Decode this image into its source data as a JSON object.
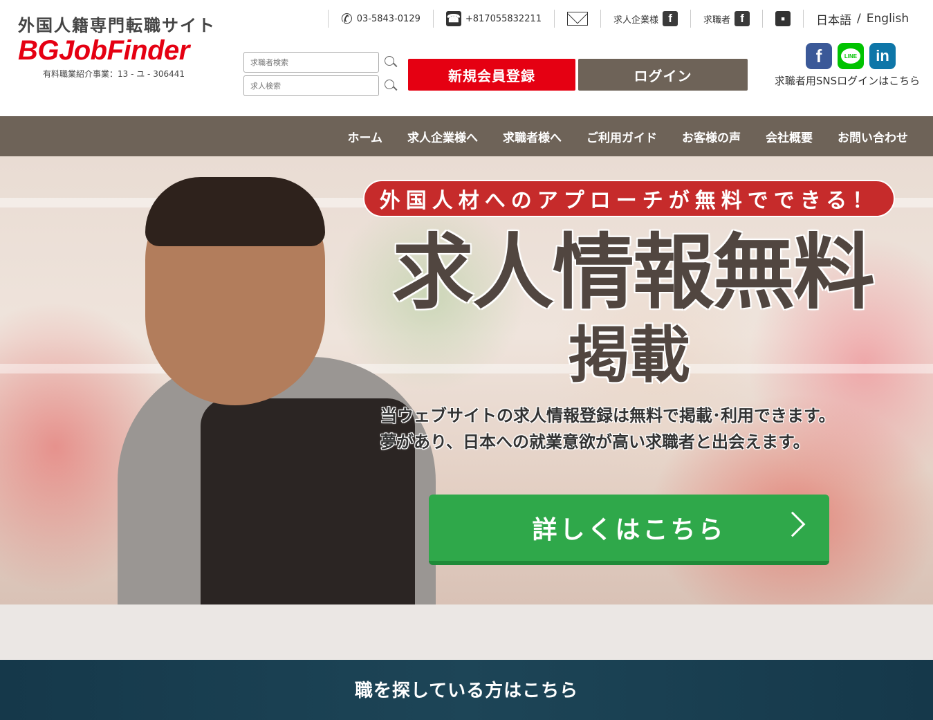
{
  "logo": {
    "tagline": "外国人籍専門転職サイト",
    "name": "BGJobFinder",
    "license": "有料職業紹介事業：13 - ユ - 306441"
  },
  "topbar": {
    "phone": "03-5843-0129",
    "viber": "+817055832211",
    "company_fb_label": "求人企業様",
    "seeker_fb_label": "求職者",
    "lang_ja": "日本語",
    "lang_sep": "/",
    "lang_en": "English"
  },
  "search": {
    "seeker_placeholder": "求職者検索",
    "job_placeholder": "求人検索"
  },
  "buttons": {
    "register": "新規会員登録",
    "login": "ログイン"
  },
  "sns": {
    "text": "求職者用SNSログインはこちら",
    "line_label": "LINE"
  },
  "nav": {
    "items": [
      "ホーム",
      "求人企業様へ",
      "求職者様へ",
      "ご利用ガイド",
      "お客様の声",
      "会社概要",
      "お問い合わせ"
    ]
  },
  "hero": {
    "badge": "外国人材へのアプローチが無料でできる！",
    "headline_line1": "求人情報無料",
    "headline_line2": "掲載",
    "desc_line1": "当ウェブサイトの求人情報登録は無料で掲載･利用できます。",
    "desc_line2": "夢があり、日本への就業意欲が高い求職者と出会えます。",
    "cta": "詳しくはこちら"
  },
  "jobseek": {
    "title": "職を探している方はこちら"
  },
  "colors": {
    "brand_red": "#e50012",
    "nav_brown": "#6e6358",
    "cta_green": "#2fa84a",
    "badge_red": "#c62b2b"
  }
}
